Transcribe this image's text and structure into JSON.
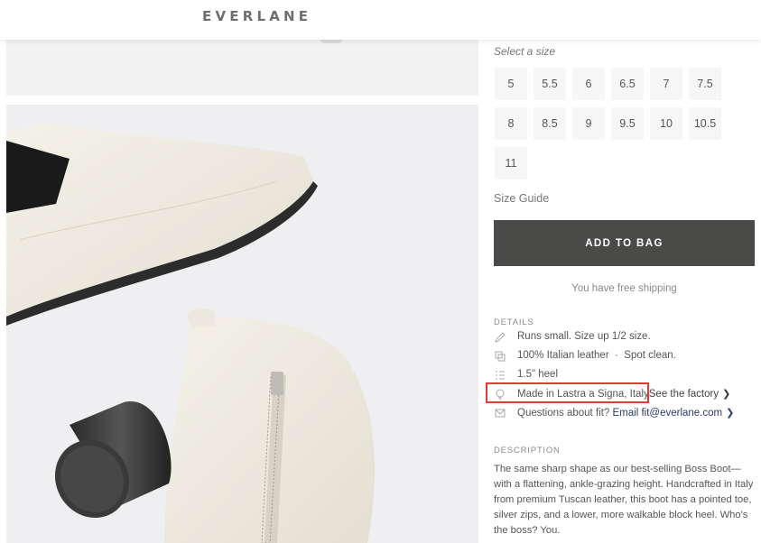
{
  "header": {
    "logo": "EVERLANE"
  },
  "size_picker": {
    "label": "Select a size",
    "sizes": [
      "5",
      "5.5",
      "6",
      "6.5",
      "7",
      "7.5",
      "8",
      "8.5",
      "9",
      "9.5",
      "10",
      "10.5",
      "11"
    ],
    "guide_label": "Size Guide"
  },
  "add_to_bag": "ADD TO BAG",
  "shipping_note": "You have free shipping",
  "details": {
    "title": "DETAILS",
    "fit": "Runs small. Size up 1/2 size.",
    "material": "100% Italian leather",
    "care": "Spot clean.",
    "heel": "1.5\" heel",
    "made_in": "Made in Lastra a Signa, Italy",
    "factory_link": "See the factory",
    "question": "Questions about fit?",
    "email_link": "Email fit@everlane.com"
  },
  "description": {
    "title": "DESCRIPTION",
    "text": "The same sharp shape as our best-selling Boss Boot—with a flattening, ankle-grazing height. Handcrafted in Italy from premium Tuscan leather, this boot has a pointed toe, silver zips, and a lower, more walkable block heel. Who's the boss? You."
  },
  "colors": {
    "button_bg": "#4a4a48",
    "highlight": "#e23b30",
    "link": "#2a3a6a"
  }
}
